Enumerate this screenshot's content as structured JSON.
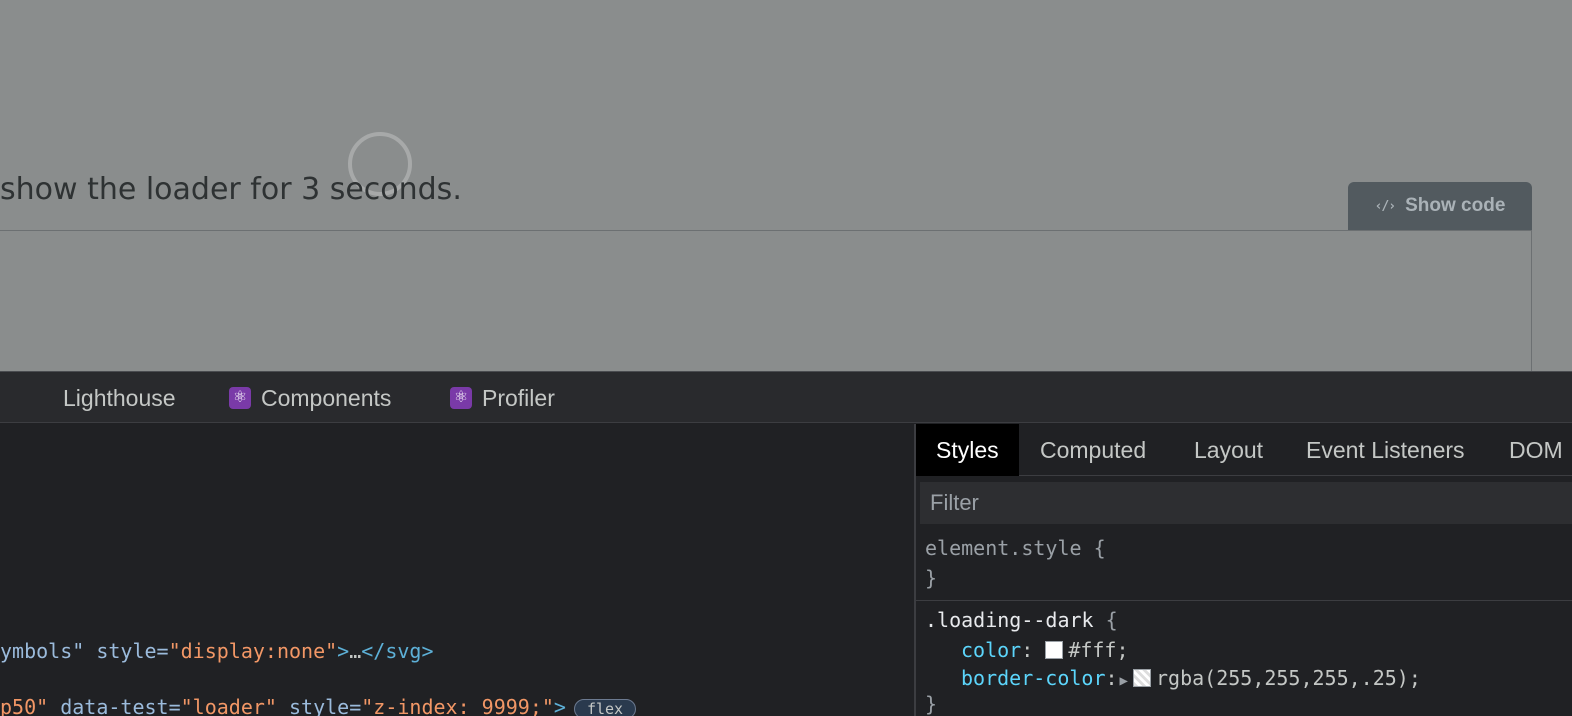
{
  "page": {
    "helper_text": "show the loader for 3 seconds.",
    "show_code_label": "Show code"
  },
  "devtools": {
    "tabs": [
      {
        "label": "Lighthouse",
        "icon": null
      },
      {
        "label": "Components",
        "icon": "react-icon"
      },
      {
        "label": "Profiler",
        "icon": "react-icon"
      }
    ],
    "elements": {
      "line1": {
        "prefix": "ymbols\"",
        "attr": "style=",
        "val": "\"display:none\"",
        "mid": ">",
        "ellipsis": "…",
        "close": "</svg>"
      },
      "line2": {
        "val1": "p50\"",
        "attr1": "data-test=",
        "val2": "\"loader\"",
        "attr2": "style=",
        "val3": "\"z-index: 9999;\"",
        "mid": ">",
        "badge": "flex"
      }
    },
    "styles": {
      "subtabs": [
        "Styles",
        "Computed",
        "Layout",
        "Event Listeners",
        "DOM"
      ],
      "active_subtab": "Styles",
      "filter_placeholder": "Filter",
      "element_style_selector": "element.style {",
      "element_style_close": "}",
      "rule_selector": ".loading--dark",
      "rule_open": "{",
      "color_prop": "color",
      "color_value": "#fff;",
      "border_prop": "border-color",
      "border_value": "rgba(255,255,255,.25);",
      "rule_close": "}"
    }
  }
}
